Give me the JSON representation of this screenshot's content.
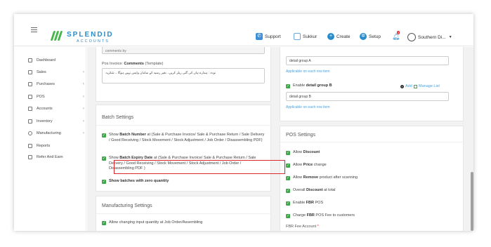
{
  "header": {
    "logo_text": "SPLENDID",
    "logo_sub": "ACCOUNTS",
    "support": "Support",
    "branch": "Sukkur",
    "create": "Create",
    "setup": "Setup",
    "notifications_count": "0",
    "user": "Southern Di..."
  },
  "sidebar": {
    "items": [
      {
        "label": "Dashboard",
        "icon": "home-icon"
      },
      {
        "label": "Sales",
        "icon": "chart-icon",
        "chevron": "‹"
      },
      {
        "label": "Purchases",
        "icon": "cart-icon",
        "chevron": "‹"
      },
      {
        "label": "POS",
        "icon": "pos-icon",
        "chevron": "‹"
      },
      {
        "label": "Accounts",
        "icon": "accounts-icon",
        "chevron": "‹"
      },
      {
        "label": "Inventory",
        "icon": "truck-icon",
        "chevron": "‹"
      },
      {
        "label": "Manufacturing",
        "icon": "gear-icon",
        "chevron": "‹"
      },
      {
        "label": "Reports",
        "icon": "report-icon"
      },
      {
        "label": "Refer And Earn",
        "icon": "refer-icon"
      }
    ]
  },
  "left_top": {
    "top_field_text": "comments by",
    "comments_label_prefix": "Pos Invoice: ",
    "comments_label_bold": "Comments",
    "comments_label_suffix": " (Template)",
    "comments_value": "نوٹ : ہمارے ہاں کی گئی ریلز کریں۔ بغیر رسید کے سامان واپس نہیں ہوگا ۔ شکریہ"
  },
  "batch": {
    "title": "Batch Settings",
    "items": [
      {
        "prefix": "Show ",
        "bold": "Batch Number",
        "rest": " at (Sale & Purchase Invoice/ Sale & Purchase Return / Sale Delivery / Good Receiving / Stock Movement / Stock Adjustment / Job Order / Disassembling PDF)"
      },
      {
        "prefix": "Show ",
        "bold": "Batch Expiry Date",
        "rest": " at (Sale & Purchase Invoice/ Sale & Purchase Return / Sale Delivery / Good Receiving / Stock Movement / Stock Adjustment / Job Order / Disassembling PDF )"
      }
    ],
    "highlight_label": "Show batches with zero quantity"
  },
  "manufacturing": {
    "title": "Manufacturing Settings",
    "item": "Allow changing input quantity at Job Order/Assembling"
  },
  "right_top": {
    "group_a_value": "detail group A",
    "group_a_link": "Applicable on each row item",
    "enable_prefix": "Enable ",
    "enable_bold": "detail group B",
    "add": "Add",
    "manage": "Manage List",
    "group_b_value": "detail group B",
    "group_b_link": "Applicable on each row item"
  },
  "pos": {
    "title": "POS Settings",
    "items": [
      {
        "prefix": "Allow ",
        "bold": "Discount",
        "rest": ""
      },
      {
        "prefix": "Allow ",
        "bold": "Price",
        "rest": " change"
      },
      {
        "prefix": "Allow ",
        "bold": "Remove",
        "rest": " product after scanning"
      },
      {
        "prefix": "Overall ",
        "bold": "Discount",
        "rest": " at total"
      },
      {
        "prefix": "Enable ",
        "bold": "FBR",
        "rest": " POS"
      },
      {
        "prefix": "Charge ",
        "bold": "FBR",
        "rest": " POS Fee to customers"
      }
    ],
    "fee_label": "FBR Fee Account",
    "required_mark": "*"
  },
  "colors": {
    "brand_blue": "#2b8ccc",
    "brand_green": "#45b649",
    "check_green": "#3fa64a",
    "highlight_red": "#d9272e",
    "link_blue": "#4aa3df"
  }
}
